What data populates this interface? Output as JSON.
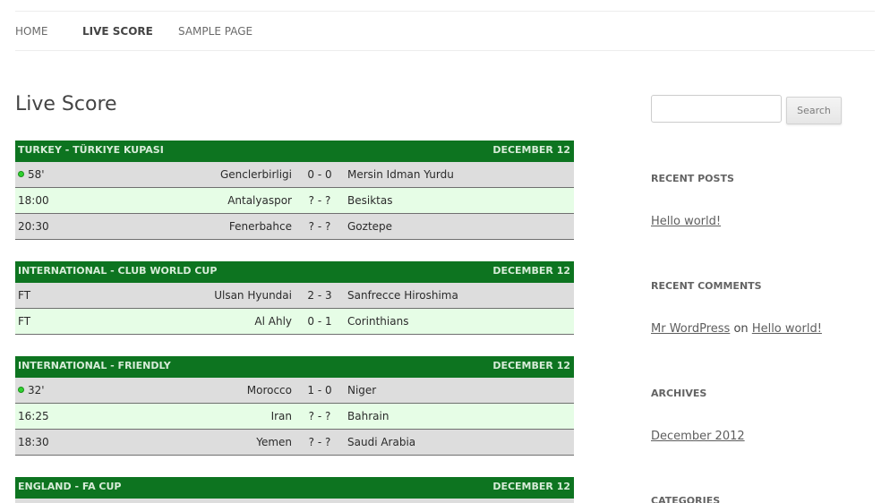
{
  "nav": {
    "items": [
      {
        "label": "HOME",
        "active": false
      },
      {
        "label": "LIVE SCORE",
        "active": true
      },
      {
        "label": "SAMPLE PAGE",
        "active": false
      }
    ]
  },
  "page": {
    "title": "Live Score"
  },
  "competitions": [
    {
      "name": "TURKEY - TÜRKIYE KUPASI",
      "date": "DECEMBER 12",
      "matches": [
        {
          "status": "58'",
          "live": true,
          "home": "Genclerbirligi",
          "score": "0 - 0",
          "away": "Mersin Idman Yurdu"
        },
        {
          "status": "18:00",
          "live": false,
          "home": "Antalyaspor",
          "score": "? - ?",
          "away": "Besiktas"
        },
        {
          "status": "20:30",
          "live": false,
          "home": "Fenerbahce",
          "score": "? - ?",
          "away": "Goztepe"
        }
      ]
    },
    {
      "name": "INTERNATIONAL - CLUB WORLD CUP",
      "date": "DECEMBER 12",
      "matches": [
        {
          "status": "FT",
          "live": false,
          "home": "Ulsan Hyundai",
          "score": "2 - 3",
          "away": "Sanfrecce Hiroshima"
        },
        {
          "status": "FT",
          "live": false,
          "home": "Al Ahly",
          "score": "0 - 1",
          "away": "Corinthians"
        }
      ]
    },
    {
      "name": "INTERNATIONAL - FRIENDLY",
      "date": "DECEMBER 12",
      "matches": [
        {
          "status": "32'",
          "live": true,
          "home": "Morocco",
          "score": "1 - 0",
          "away": "Niger"
        },
        {
          "status": "16:25",
          "live": false,
          "home": "Iran",
          "score": "? - ?",
          "away": "Bahrain"
        },
        {
          "status": "18:30",
          "live": false,
          "home": "Yemen",
          "score": "? - ?",
          "away": "Saudi Arabia"
        }
      ]
    },
    {
      "name": "ENGLAND - FA CUP",
      "date": "DECEMBER 12",
      "matches": []
    }
  ],
  "sidebar": {
    "search": {
      "value": "",
      "button_label": "Search"
    },
    "recent_posts": {
      "title": "RECENT POSTS",
      "items": [
        "Hello world!"
      ]
    },
    "recent_comments": {
      "title": "RECENT COMMENTS",
      "author": "Mr WordPress",
      "connector": "on",
      "post": "Hello world!"
    },
    "archives": {
      "title": "ARCHIVES",
      "items": [
        "December 2012"
      ]
    },
    "categories": {
      "title": "CATEGORIES"
    }
  },
  "colors": {
    "header_green": "#0d7420",
    "row_odd": "#dddddd",
    "row_even": "#e6fde6",
    "live_dot": "#2fd12f"
  }
}
